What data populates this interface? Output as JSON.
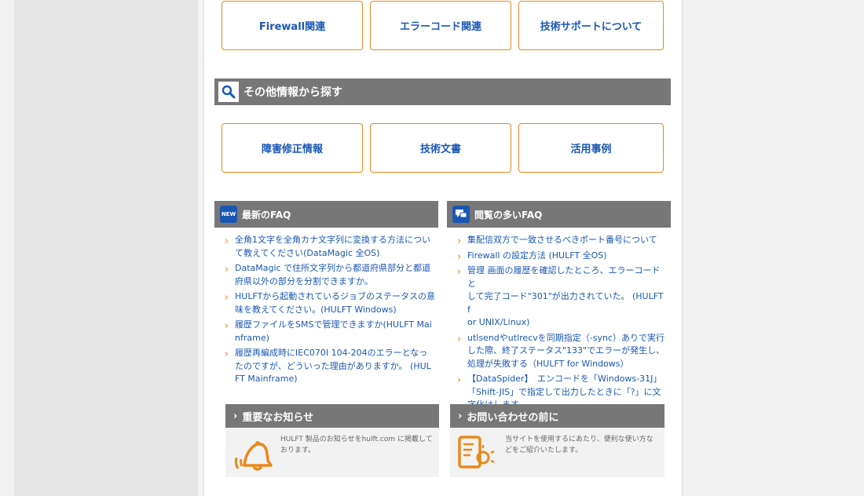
{
  "top_buttons": [
    "Firewall関連",
    "エラーコード関連",
    "技術サポートについて"
  ],
  "other_section": {
    "title": "その他情報から探す",
    "buttons": [
      "障害修正情報",
      "技術文書",
      "活用事例"
    ]
  },
  "latest_faq": {
    "title": "最新のFAQ",
    "icon_text": "NEW",
    "items": [
      {
        "line1": "全角1文字を全角カナ文字列に変換する方法につい",
        "line2": "て教えてください(DataMagic 全OS)"
      },
      {
        "line1": "DataMagic で住所文字列から都道府県部分と都道",
        "line2": "府県以外の部分を分割できますか。"
      },
      {
        "line1": "HULFTから起動されているジョブのステータスの意",
        "line2": "味を教えてください。(HULFT Windows)"
      },
      {
        "line1": "履歴ファイルをSMSで管理できますか(HULFT Mai",
        "line2": "nframe)"
      },
      {
        "line1": "履歴再編成時にIEC070I 104-204のエラーとなっ",
        "line2": "たのですが、どういった理由がありますか。 (HUL",
        "line3": "FT Mainframe)"
      }
    ]
  },
  "popular_faq": {
    "title": "閲覧の多いFAQ",
    "items": [
      {
        "line1": "集配信双方で一致させるべきポート番号について"
      },
      {
        "line1": "Firewall の設定方法 (HULFT 全OS)"
      },
      {
        "line1": "管理 画面の履歴を確認したところ、エラーコードと",
        "line2": "して完了コード\"301\"が出力されていた。 (HULFT f",
        "line3": "or UNIX/Linux)"
      },
      {
        "line1": "utlsendやutlrecvを同期指定（-sync）ありで実行",
        "line2": "した際、終了ステータス\"133\"でエラーが発生し、",
        "line3": "処理が失敗する（HULFT for Windows）"
      },
      {
        "line1": "【DataSpider】　エンコードを「Windows-31J」",
        "line2": "「Shift-JIS」で指定して出力したときに「?」に文",
        "line3": "字化けします"
      }
    ]
  },
  "notice": {
    "title": "重要なお知らせ",
    "text": "HULFT 製品のお知らせをhulft.com に掲載しております。",
    "icon": "bell-icon"
  },
  "contact": {
    "title": "お問い合わせの前に",
    "text": "当サイトを使用するにあたり、便利な使い方などをご紹介いたします。",
    "icon": "document-bulb-icon"
  },
  "colors": {
    "accent_orange": "#e8891c",
    "link_blue": "#1a57b4",
    "bar_gray": "#777777"
  }
}
